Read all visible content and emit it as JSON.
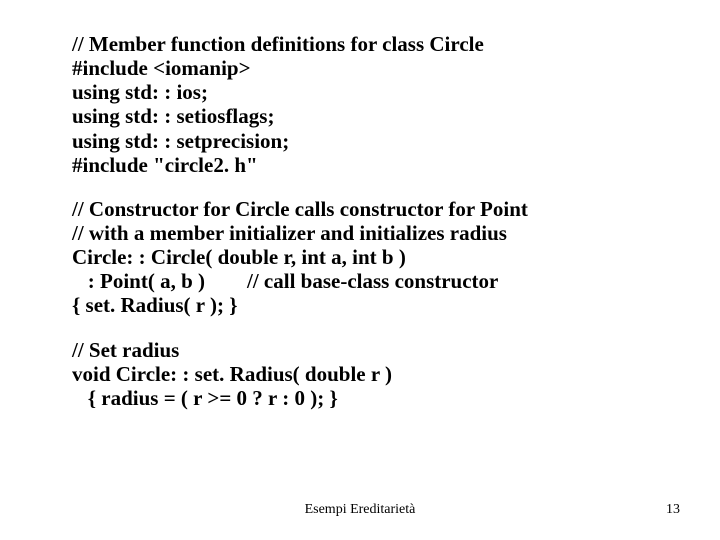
{
  "code": {
    "block1": [
      "// Member function definitions for class Circle",
      "#include <iomanip>",
      "using std: : ios;",
      "using std: : setiosflags;",
      "using std: : setprecision;",
      "#include \"circle2. h\""
    ],
    "block2": [
      "// Constructor for Circle calls constructor for Point",
      "// with a member initializer and initializes radius",
      "Circle: : Circle( double r, int a, int b )",
      "   : Point( a, b )        // call base-class constructor",
      "{ set. Radius( r ); }"
    ],
    "block3": [
      "// Set radius",
      "void Circle: : set. Radius( double r )",
      "   { radius = ( r >= 0 ? r : 0 ); }"
    ]
  },
  "footer": {
    "center": "Esempi Ereditarietà",
    "page": "13"
  }
}
